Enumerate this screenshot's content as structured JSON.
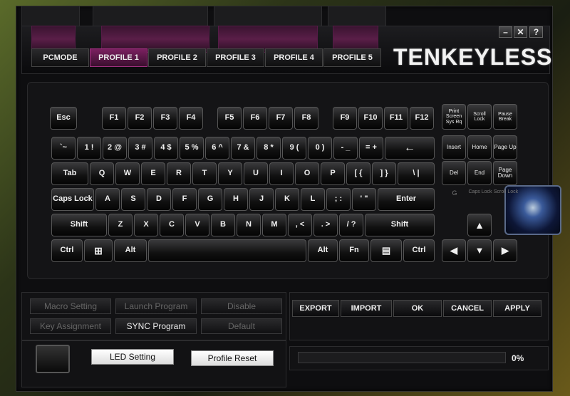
{
  "window": {
    "brand": "TENKEYLESS",
    "minimize": "–",
    "close": "✕",
    "help": "?"
  },
  "profile_tabs": [
    "PCMODE",
    "PROFILE 1",
    "PROFILE 2",
    "PROFILE 3",
    "PROFILE 4",
    "PROFILE 5"
  ],
  "active_tab": "PROFILE 1",
  "keys": {
    "row_f": [
      "Esc",
      "F1",
      "F2",
      "F3",
      "F4",
      "F5",
      "F6",
      "F7",
      "F8",
      "F9",
      "F10",
      "F11",
      "F12"
    ],
    "sys": [
      "Print Screen Sys Rq",
      "Scroll Lock",
      "Pause Break"
    ],
    "row_num": [
      "`~",
      "1 !",
      "2 @",
      "3 #",
      "4 $",
      "5 %",
      "6 ^",
      "7 &",
      "8 *",
      "9 (",
      "0 )",
      "- _",
      "= +",
      "←"
    ],
    "nav1": [
      "Insert",
      "Home",
      "Page Up"
    ],
    "row_tab": [
      "Tab",
      "Q",
      "W",
      "E",
      "R",
      "T",
      "Y",
      "U",
      "I",
      "O",
      "P",
      "[ {",
      "] }",
      "\\ |"
    ],
    "nav2": [
      "Del",
      "End",
      "Page Down"
    ],
    "row_caps": [
      "Caps Lock",
      "A",
      "S",
      "D",
      "F",
      "G",
      "H",
      "J",
      "K",
      "L",
      ";  :",
      "'  \"",
      "Enter"
    ],
    "leds": [
      "G",
      "Caps Lock",
      "Scroll Lock"
    ],
    "row_shift": [
      "Shift",
      "Z",
      "X",
      "C",
      "V",
      "B",
      "N",
      "M",
      ", <",
      ". >",
      "/ ?",
      "Shift"
    ],
    "row_ctrl": [
      "Ctrl",
      "Alt",
      "Alt",
      "Fn",
      "Ctrl"
    ],
    "arrows": [
      "▲",
      "◀",
      "▼",
      "▶"
    ]
  },
  "functions": {
    "macro": "Macro Setting",
    "launch": "Launch Program",
    "disable": "Disable",
    "key_assign": "Key Assignment",
    "sync": "SYNC Program",
    "default": "Default"
  },
  "actions": [
    "EXPORT",
    "IMPORT",
    "OK",
    "CANCEL",
    "APPLY"
  ],
  "led_setting": "LED Setting",
  "profile_reset": "Profile Reset",
  "progress": {
    "value": 0,
    "label": "0%"
  }
}
